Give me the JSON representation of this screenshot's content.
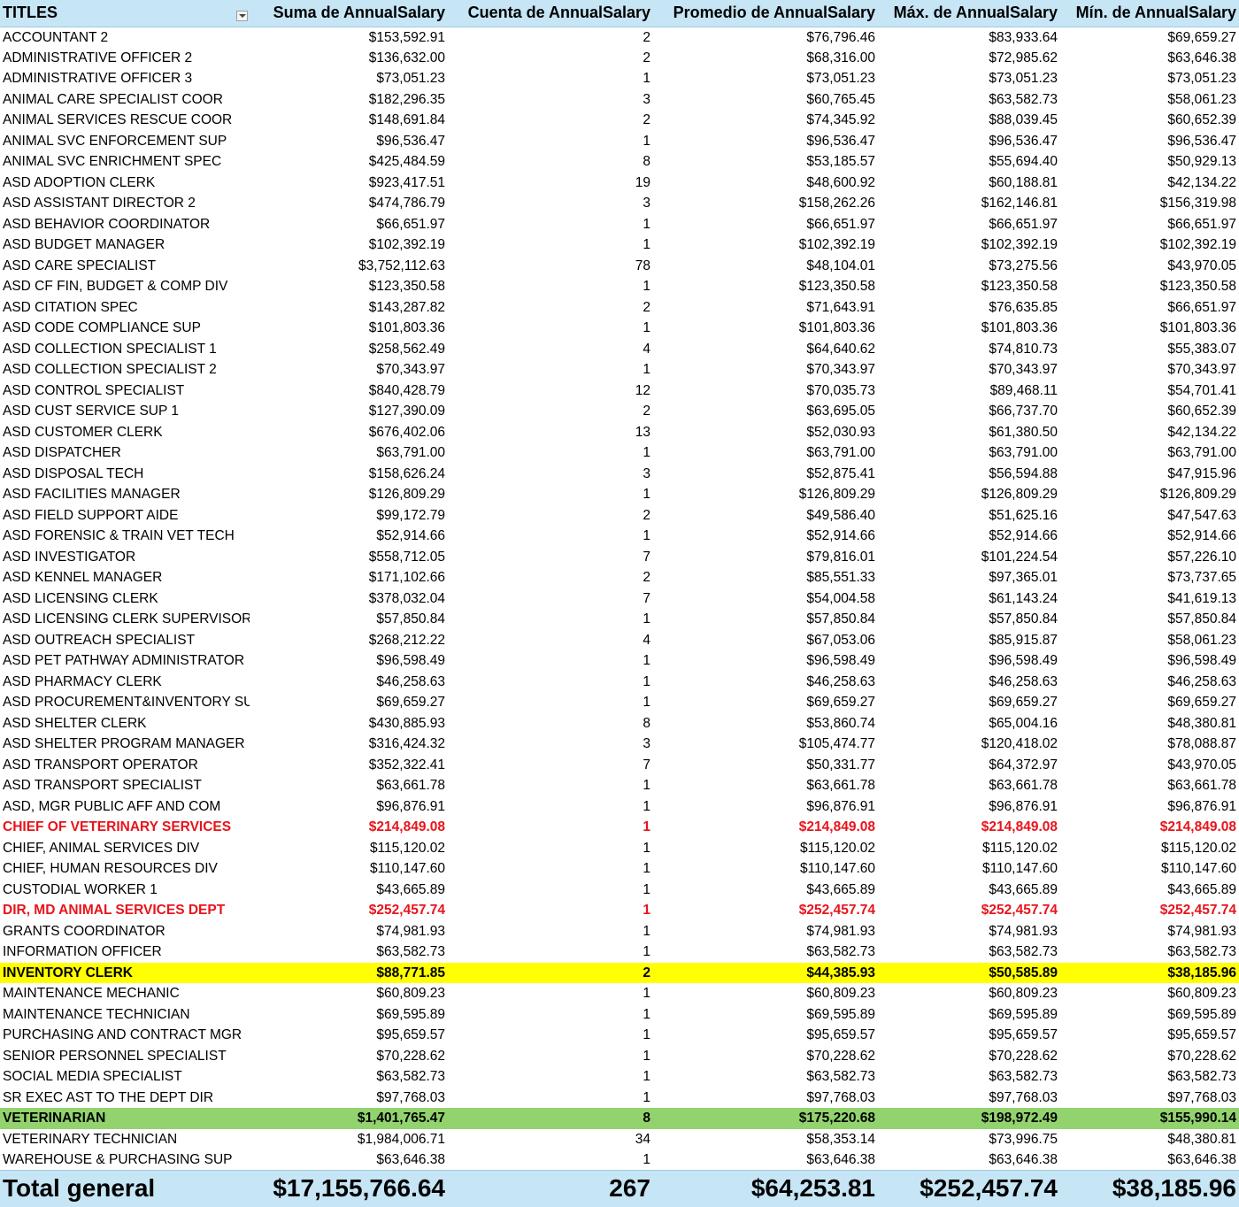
{
  "headers": [
    "TITLES",
    "Suma de AnnualSalary",
    "Cuenta de AnnualSalary",
    "Promedio de AnnualSalary",
    "Máx. de AnnualSalary",
    "Mín. de AnnualSalary"
  ],
  "highlight_colors": {
    "red": "#e8141b",
    "yellow": "#ffff00",
    "green": "#92d36e",
    "header": "#c6e5f5"
  },
  "rows": [
    {
      "title": "ACCOUNTANT 2",
      "sum": "$153,592.91",
      "count": "2",
      "avg": "$76,796.46",
      "max": "$83,933.64",
      "min": "$69,659.27"
    },
    {
      "title": "ADMINISTRATIVE OFFICER 2",
      "sum": "$136,632.00",
      "count": "2",
      "avg": "$68,316.00",
      "max": "$72,985.62",
      "min": "$63,646.38"
    },
    {
      "title": "ADMINISTRATIVE OFFICER 3",
      "sum": "$73,051.23",
      "count": "1",
      "avg": "$73,051.23",
      "max": "$73,051.23",
      "min": "$73,051.23"
    },
    {
      "title": "ANIMAL CARE SPECIALIST COOR",
      "sum": "$182,296.35",
      "count": "3",
      "avg": "$60,765.45",
      "max": "$63,582.73",
      "min": "$58,061.23"
    },
    {
      "title": "ANIMAL SERVICES RESCUE COOR",
      "sum": "$148,691.84",
      "count": "2",
      "avg": "$74,345.92",
      "max": "$88,039.45",
      "min": "$60,652.39"
    },
    {
      "title": "ANIMAL SVC ENFORCEMENT SUP",
      "sum": "$96,536.47",
      "count": "1",
      "avg": "$96,536.47",
      "max": "$96,536.47",
      "min": "$96,536.47"
    },
    {
      "title": "ANIMAL SVC ENRICHMENT SPEC",
      "sum": "$425,484.59",
      "count": "8",
      "avg": "$53,185.57",
      "max": "$55,694.40",
      "min": "$50,929.13"
    },
    {
      "title": "ASD ADOPTION CLERK",
      "sum": "$923,417.51",
      "count": "19",
      "avg": "$48,600.92",
      "max": "$60,188.81",
      "min": "$42,134.22"
    },
    {
      "title": "ASD ASSISTANT DIRECTOR 2",
      "sum": "$474,786.79",
      "count": "3",
      "avg": "$158,262.26",
      "max": "$162,146.81",
      "min": "$156,319.98"
    },
    {
      "title": "ASD BEHAVIOR COORDINATOR",
      "sum": "$66,651.97",
      "count": "1",
      "avg": "$66,651.97",
      "max": "$66,651.97",
      "min": "$66,651.97"
    },
    {
      "title": "ASD BUDGET MANAGER",
      "sum": "$102,392.19",
      "count": "1",
      "avg": "$102,392.19",
      "max": "$102,392.19",
      "min": "$102,392.19"
    },
    {
      "title": "ASD CARE SPECIALIST",
      "sum": "$3,752,112.63",
      "count": "78",
      "avg": "$48,104.01",
      "max": "$73,275.56",
      "min": "$43,970.05"
    },
    {
      "title": "ASD CF FIN, BUDGET & COMP DIV",
      "sum": "$123,350.58",
      "count": "1",
      "avg": "$123,350.58",
      "max": "$123,350.58",
      "min": "$123,350.58"
    },
    {
      "title": "ASD CITATION SPEC",
      "sum": "$143,287.82",
      "count": "2",
      "avg": "$71,643.91",
      "max": "$76,635.85",
      "min": "$66,651.97"
    },
    {
      "title": "ASD CODE COMPLIANCE SUP",
      "sum": "$101,803.36",
      "count": "1",
      "avg": "$101,803.36",
      "max": "$101,803.36",
      "min": "$101,803.36"
    },
    {
      "title": "ASD COLLECTION SPECIALIST 1",
      "sum": "$258,562.49",
      "count": "4",
      "avg": "$64,640.62",
      "max": "$74,810.73",
      "min": "$55,383.07"
    },
    {
      "title": "ASD COLLECTION SPECIALIST 2",
      "sum": "$70,343.97",
      "count": "1",
      "avg": "$70,343.97",
      "max": "$70,343.97",
      "min": "$70,343.97"
    },
    {
      "title": "ASD CONTROL SPECIALIST",
      "sum": "$840,428.79",
      "count": "12",
      "avg": "$70,035.73",
      "max": "$89,468.11",
      "min": "$54,701.41"
    },
    {
      "title": "ASD CUST SERVICE SUP 1",
      "sum": "$127,390.09",
      "count": "2",
      "avg": "$63,695.05",
      "max": "$66,737.70",
      "min": "$60,652.39"
    },
    {
      "title": "ASD CUSTOMER CLERK",
      "sum": "$676,402.06",
      "count": "13",
      "avg": "$52,030.93",
      "max": "$61,380.50",
      "min": "$42,134.22"
    },
    {
      "title": "ASD DISPATCHER",
      "sum": "$63,791.00",
      "count": "1",
      "avg": "$63,791.00",
      "max": "$63,791.00",
      "min": "$63,791.00"
    },
    {
      "title": "ASD DISPOSAL TECH",
      "sum": "$158,626.24",
      "count": "3",
      "avg": "$52,875.41",
      "max": "$56,594.88",
      "min": "$47,915.96"
    },
    {
      "title": "ASD FACILITIES MANAGER",
      "sum": "$126,809.29",
      "count": "1",
      "avg": "$126,809.29",
      "max": "$126,809.29",
      "min": "$126,809.29"
    },
    {
      "title": "ASD FIELD SUPPORT AIDE",
      "sum": "$99,172.79",
      "count": "2",
      "avg": "$49,586.40",
      "max": "$51,625.16",
      "min": "$47,547.63"
    },
    {
      "title": "ASD FORENSIC & TRAIN VET TECH",
      "sum": "$52,914.66",
      "count": "1",
      "avg": "$52,914.66",
      "max": "$52,914.66",
      "min": "$52,914.66"
    },
    {
      "title": "ASD INVESTIGATOR",
      "sum": "$558,712.05",
      "count": "7",
      "avg": "$79,816.01",
      "max": "$101,224.54",
      "min": "$57,226.10"
    },
    {
      "title": "ASD KENNEL MANAGER",
      "sum": "$171,102.66",
      "count": "2",
      "avg": "$85,551.33",
      "max": "$97,365.01",
      "min": "$73,737.65"
    },
    {
      "title": "ASD LICENSING CLERK",
      "sum": "$378,032.04",
      "count": "7",
      "avg": "$54,004.58",
      "max": "$61,143.24",
      "min": "$41,619.13"
    },
    {
      "title": "ASD LICENSING CLERK SUPERVISOR",
      "sum": "$57,850.84",
      "count": "1",
      "avg": "$57,850.84",
      "max": "$57,850.84",
      "min": "$57,850.84"
    },
    {
      "title": "ASD OUTREACH SPECIALIST",
      "sum": "$268,212.22",
      "count": "4",
      "avg": "$67,053.06",
      "max": "$85,915.87",
      "min": "$58,061.23"
    },
    {
      "title": "ASD PET PATHWAY ADMINISTRATOR",
      "sum": "$96,598.49",
      "count": "1",
      "avg": "$96,598.49",
      "max": "$96,598.49",
      "min": "$96,598.49"
    },
    {
      "title": "ASD PHARMACY CLERK",
      "sum": "$46,258.63",
      "count": "1",
      "avg": "$46,258.63",
      "max": "$46,258.63",
      "min": "$46,258.63"
    },
    {
      "title": "ASD PROCUREMENT&INVENTORY SUP",
      "sum": "$69,659.27",
      "count": "1",
      "avg": "$69,659.27",
      "max": "$69,659.27",
      "min": "$69,659.27"
    },
    {
      "title": "ASD SHELTER CLERK",
      "sum": "$430,885.93",
      "count": "8",
      "avg": "$53,860.74",
      "max": "$65,004.16",
      "min": "$48,380.81"
    },
    {
      "title": "ASD SHELTER PROGRAM MANAGER",
      "sum": "$316,424.32",
      "count": "3",
      "avg": "$105,474.77",
      "max": "$120,418.02",
      "min": "$78,088.87"
    },
    {
      "title": "ASD TRANSPORT OPERATOR",
      "sum": "$352,322.41",
      "count": "7",
      "avg": "$50,331.77",
      "max": "$64,372.97",
      "min": "$43,970.05"
    },
    {
      "title": "ASD TRANSPORT SPECIALIST",
      "sum": "$63,661.78",
      "count": "1",
      "avg": "$63,661.78",
      "max": "$63,661.78",
      "min": "$63,661.78"
    },
    {
      "title": "ASD, MGR PUBLIC AFF AND COM",
      "sum": "$96,876.91",
      "count": "1",
      "avg": "$96,876.91",
      "max": "$96,876.91",
      "min": "$96,876.91"
    },
    {
      "title": "CHIEF OF VETERINARY SERVICES",
      "sum": "$214,849.08",
      "count": "1",
      "avg": "$214,849.08",
      "max": "$214,849.08",
      "min": "$214,849.08",
      "style": "red"
    },
    {
      "title": "CHIEF, ANIMAL SERVICES DIV",
      "sum": "$115,120.02",
      "count": "1",
      "avg": "$115,120.02",
      "max": "$115,120.02",
      "min": "$115,120.02"
    },
    {
      "title": "CHIEF, HUMAN RESOURCES DIV",
      "sum": "$110,147.60",
      "count": "1",
      "avg": "$110,147.60",
      "max": "$110,147.60",
      "min": "$110,147.60"
    },
    {
      "title": "CUSTODIAL WORKER 1",
      "sum": "$43,665.89",
      "count": "1",
      "avg": "$43,665.89",
      "max": "$43,665.89",
      "min": "$43,665.89"
    },
    {
      "title": "DIR, MD ANIMAL SERVICES DEPT",
      "sum": "$252,457.74",
      "count": "1",
      "avg": "$252,457.74",
      "max": "$252,457.74",
      "min": "$252,457.74",
      "style": "red"
    },
    {
      "title": "GRANTS COORDINATOR",
      "sum": "$74,981.93",
      "count": "1",
      "avg": "$74,981.93",
      "max": "$74,981.93",
      "min": "$74,981.93"
    },
    {
      "title": "INFORMATION OFFICER",
      "sum": "$63,582.73",
      "count": "1",
      "avg": "$63,582.73",
      "max": "$63,582.73",
      "min": "$63,582.73"
    },
    {
      "title": "INVENTORY CLERK",
      "sum": "$88,771.85",
      "count": "2",
      "avg": "$44,385.93",
      "max": "$50,585.89",
      "min": "$38,185.96",
      "style": "yellow"
    },
    {
      "title": "MAINTENANCE MECHANIC",
      "sum": "$60,809.23",
      "count": "1",
      "avg": "$60,809.23",
      "max": "$60,809.23",
      "min": "$60,809.23"
    },
    {
      "title": "MAINTENANCE TECHNICIAN",
      "sum": "$69,595.89",
      "count": "1",
      "avg": "$69,595.89",
      "max": "$69,595.89",
      "min": "$69,595.89"
    },
    {
      "title": "PURCHASING AND CONTRACT MGR",
      "sum": "$95,659.57",
      "count": "1",
      "avg": "$95,659.57",
      "max": "$95,659.57",
      "min": "$95,659.57"
    },
    {
      "title": "SENIOR PERSONNEL SPECIALIST",
      "sum": "$70,228.62",
      "count": "1",
      "avg": "$70,228.62",
      "max": "$70,228.62",
      "min": "$70,228.62"
    },
    {
      "title": "SOCIAL MEDIA SPECIALIST",
      "sum": "$63,582.73",
      "count": "1",
      "avg": "$63,582.73",
      "max": "$63,582.73",
      "min": "$63,582.73"
    },
    {
      "title": "SR EXEC AST TO THE DEPT DIR",
      "sum": "$97,768.03",
      "count": "1",
      "avg": "$97,768.03",
      "max": "$97,768.03",
      "min": "$97,768.03"
    },
    {
      "title": "VETERINARIAN",
      "sum": "$1,401,765.47",
      "count": "8",
      "avg": "$175,220.68",
      "max": "$198,972.49",
      "min": "$155,990.14",
      "style": "green"
    },
    {
      "title": "VETERINARY TECHNICIAN",
      "sum": "$1,984,006.71",
      "count": "34",
      "avg": "$58,353.14",
      "max": "$73,996.75",
      "min": "$48,380.81"
    },
    {
      "title": "WAREHOUSE & PURCHASING SUP",
      "sum": "$63,646.38",
      "count": "1",
      "avg": "$63,646.38",
      "max": "$63,646.38",
      "min": "$63,646.38"
    }
  ],
  "total": {
    "title": "Total general",
    "sum": "$17,155,766.64",
    "count": "267",
    "avg": "$64,253.81",
    "max": "$252,457.74",
    "min": "$38,185.96"
  }
}
